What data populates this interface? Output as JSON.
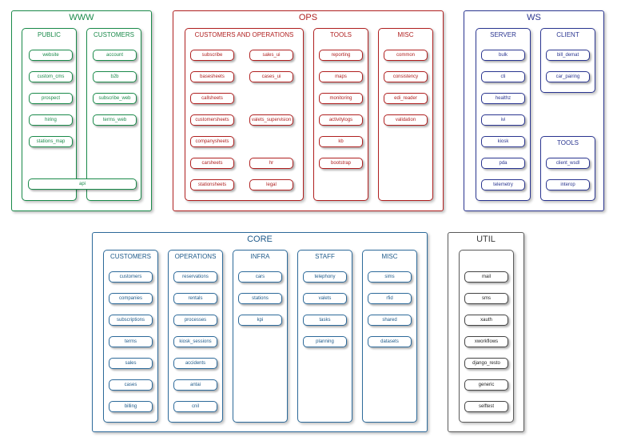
{
  "colors": {
    "www": "#1a8a4a",
    "ops": "#b02020",
    "ws": "#2a3590",
    "core": "#2d6a9a",
    "util": "#5a5a5a"
  },
  "www": {
    "title": "WWW",
    "public": {
      "title": "PUBLIC",
      "items": [
        "website",
        "custom_cms",
        "prospect",
        "hiring",
        "stations_map"
      ]
    },
    "customers": {
      "title": "CUSTOMERS",
      "items": [
        "account",
        "b2b",
        "subscribe_web",
        "terms_web"
      ]
    },
    "api": "api"
  },
  "ops": {
    "title": "OPS",
    "custops": {
      "title": "CUSTOMERS AND OPERATIONS",
      "left": [
        "subscribe",
        "basesheets",
        "callsheets",
        "customersheets",
        "companysheets",
        "carsheets",
        "stationsheets"
      ],
      "right": [
        "sales_ui",
        "cases_ui",
        "",
        "valets_supervision",
        "",
        "hr",
        "legal"
      ]
    },
    "tools": {
      "title": "TOOLS",
      "items": [
        "reporting",
        "maps",
        "monitoring",
        "activitylogs",
        "kb",
        "bootstrap"
      ]
    },
    "misc": {
      "title": "MISC",
      "items": [
        "common",
        "consistency",
        "edi_reader",
        "validation"
      ]
    }
  },
  "ws": {
    "title": "WS",
    "server": {
      "title": "SERVER",
      "items": [
        "bulk",
        "cti",
        "healthz",
        "ivi",
        "kiosk",
        "pda",
        "telemetry"
      ]
    },
    "client": {
      "title": "CLIENT",
      "items": [
        "bill_demat",
        "car_pairing"
      ]
    },
    "tools": {
      "title": "TOOLS",
      "items": [
        "client_wsdl",
        "interop"
      ]
    }
  },
  "core": {
    "title": "CORE",
    "customers": {
      "title": "CUSTOMERS",
      "items": [
        "customers",
        "companies",
        "subscriptions",
        "terms",
        "sales",
        "cases",
        "billing"
      ]
    },
    "operations": {
      "title": "OPERATIONS",
      "items": [
        "reservations",
        "rentals",
        "processes",
        "kiosk_sessions",
        "accidents",
        "antai",
        "cnil"
      ]
    },
    "infra": {
      "title": "INFRA",
      "items": [
        "cars",
        "stations",
        "kpi"
      ]
    },
    "staff": {
      "title": "STAFF",
      "items": [
        "telephony",
        "valets",
        "tasks",
        "planning"
      ]
    },
    "misc": {
      "title": "MISC",
      "items": [
        "sims",
        "rfid",
        "shared",
        "datasets"
      ]
    }
  },
  "util": {
    "title": "UTIL",
    "items": [
      "mail",
      "sms",
      "xauth",
      "xworkflows",
      "django_resto",
      "generic",
      "selftest"
    ]
  }
}
